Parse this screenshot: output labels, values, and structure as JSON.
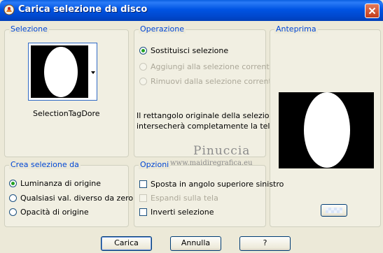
{
  "window": {
    "title": "Carica selezione da disco",
    "icons": {
      "app": "psp-app-icon",
      "close": "close-icon"
    }
  },
  "selection": {
    "group_title": "Selezione",
    "file_name": "SelectionTagDore"
  },
  "operation": {
    "group_title": "Operazione",
    "options": [
      {
        "label": "Sostituisci selezione",
        "checked": true,
        "enabled": true
      },
      {
        "label": "Aggiungi alla selezione corrente",
        "checked": false,
        "enabled": false
      },
      {
        "label": "Rimuovi dalla selezione corrente",
        "checked": false,
        "enabled": false
      }
    ],
    "info_line1": "Il rettangolo originale della selezione",
    "info_line2": "intersecherà completamente la tela."
  },
  "preview": {
    "group_title": "Anteprima"
  },
  "create_from": {
    "group_title": "Crea selezione da",
    "options": [
      {
        "label": "Luminanza di origine",
        "checked": true
      },
      {
        "label": "Qualsiasi val. diverso da zero",
        "checked": false
      },
      {
        "label": "Opacità di origine",
        "checked": false
      }
    ]
  },
  "options": {
    "group_title": "Opzioni",
    "items": [
      {
        "label": "Sposta in angolo superiore sinistro",
        "checked": false,
        "enabled": true
      },
      {
        "label": "Espandi sulla tela",
        "checked": false,
        "enabled": false
      },
      {
        "label": "Inverti selezione",
        "checked": false,
        "enabled": true
      }
    ]
  },
  "buttons": {
    "load": "Carica",
    "cancel": "Annulla",
    "help": "?"
  },
  "watermark": {
    "name": "Pinuccia",
    "url": "www.maidiregrafica.eu"
  },
  "colors": {
    "titlebar": "#0054e3",
    "dialog_bg": "#ece9d8",
    "group_title": "#0046d5",
    "radio_dot": "#21a121",
    "disabled_text": "#aca899"
  }
}
